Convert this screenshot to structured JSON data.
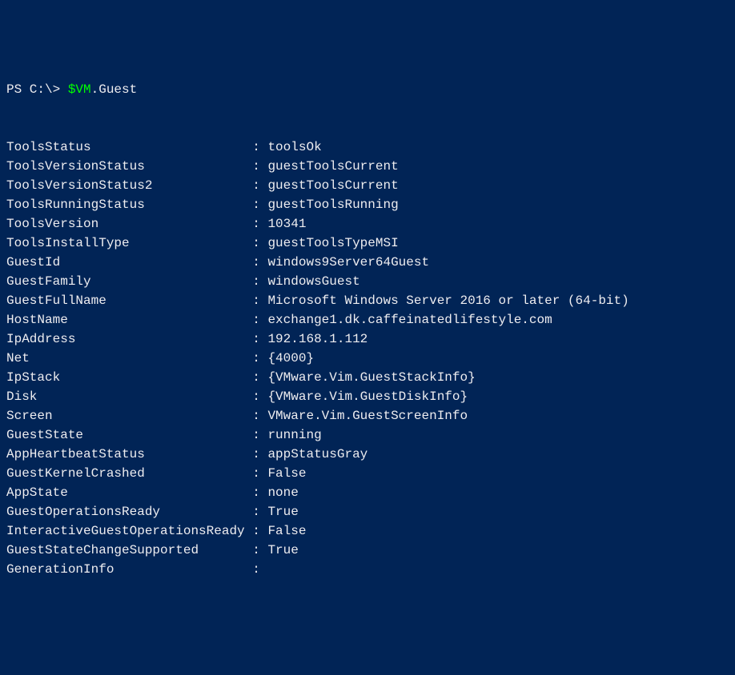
{
  "prompt": {
    "prefix": "PS C:\\> ",
    "variable": "$VM",
    "suffix": ".Guest"
  },
  "properties": [
    {
      "name": "ToolsStatus",
      "value": "toolsOk"
    },
    {
      "name": "ToolsVersionStatus",
      "value": "guestToolsCurrent"
    },
    {
      "name": "ToolsVersionStatus2",
      "value": "guestToolsCurrent"
    },
    {
      "name": "ToolsRunningStatus",
      "value": "guestToolsRunning"
    },
    {
      "name": "ToolsVersion",
      "value": "10341"
    },
    {
      "name": "ToolsInstallType",
      "value": "guestToolsTypeMSI"
    },
    {
      "name": "GuestId",
      "value": "windows9Server64Guest"
    },
    {
      "name": "GuestFamily",
      "value": "windowsGuest"
    },
    {
      "name": "GuestFullName",
      "value": "Microsoft Windows Server 2016 or later (64-bit)"
    },
    {
      "name": "HostName",
      "value": "exchange1.dk.caffeinatedlifestyle.com"
    },
    {
      "name": "IpAddress",
      "value": "192.168.1.112"
    },
    {
      "name": "Net",
      "value": "{4000}"
    },
    {
      "name": "IpStack",
      "value": "{VMware.Vim.GuestStackInfo}"
    },
    {
      "name": "Disk",
      "value": "{VMware.Vim.GuestDiskInfo}"
    },
    {
      "name": "Screen",
      "value": "VMware.Vim.GuestScreenInfo"
    },
    {
      "name": "GuestState",
      "value": "running"
    },
    {
      "name": "AppHeartbeatStatus",
      "value": "appStatusGray"
    },
    {
      "name": "GuestKernelCrashed",
      "value": "False"
    },
    {
      "name": "AppState",
      "value": "none"
    },
    {
      "name": "GuestOperationsReady",
      "value": "True"
    },
    {
      "name": "InteractiveGuestOperationsReady",
      "value": "False"
    },
    {
      "name": "GuestStateChangeSupported",
      "value": "True"
    },
    {
      "name": "GenerationInfo",
      "value": ""
    }
  ],
  "nameColumnWidth": 32
}
